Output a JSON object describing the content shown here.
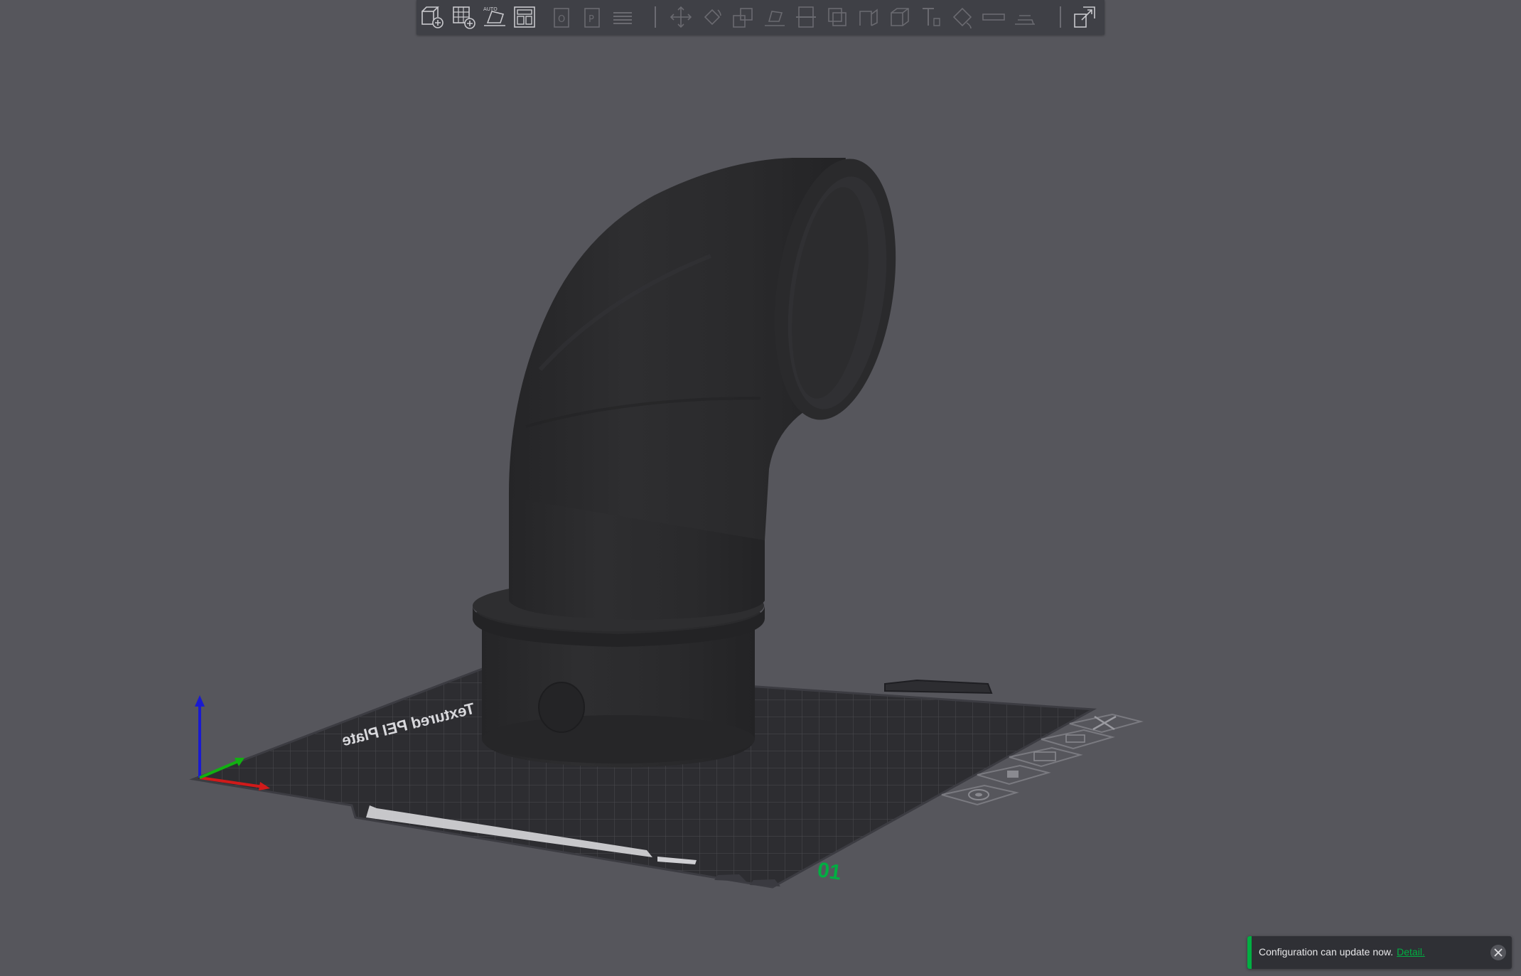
{
  "toolbar": {
    "buttons": [
      {
        "name": "add-object-icon",
        "enabled": true
      },
      {
        "name": "add-plate-icon",
        "enabled": true
      },
      {
        "name": "auto-orient-icon",
        "enabled": true
      },
      {
        "name": "arrange-icon",
        "enabled": true
      },
      {
        "name": "split-objects-icon",
        "enabled": false
      },
      {
        "name": "split-parts-icon",
        "enabled": false
      },
      {
        "name": "layers-editing-icon",
        "enabled": false
      },
      {
        "name": "move-icon",
        "enabled": false
      },
      {
        "name": "rotate-icon",
        "enabled": false
      },
      {
        "name": "scale-icon",
        "enabled": false
      },
      {
        "name": "lay-on-face-icon",
        "enabled": false
      },
      {
        "name": "cut-icon",
        "enabled": false
      },
      {
        "name": "support-paint-icon",
        "enabled": false
      },
      {
        "name": "seam-paint-icon",
        "enabled": false
      },
      {
        "name": "boolean-icon",
        "enabled": false
      },
      {
        "name": "text-emboss-icon",
        "enabled": false
      },
      {
        "name": "color-paint-icon",
        "enabled": false
      },
      {
        "name": "measure-icon",
        "enabled": false
      },
      {
        "name": "assembly-icon",
        "enabled": false
      },
      {
        "name": "assembly-view-icon",
        "enabled": true
      }
    ]
  },
  "plate": {
    "brand_text": "Textured PEI Plate",
    "plate_number": "01",
    "accent_color": "#00ae42"
  },
  "notification": {
    "message": "Configuration can update now.",
    "link_text": "Detail."
  },
  "colors": {
    "background": "#56565c",
    "toolbar": "#3f4046",
    "accent": "#00ae42",
    "model": "#2a2a2c"
  }
}
